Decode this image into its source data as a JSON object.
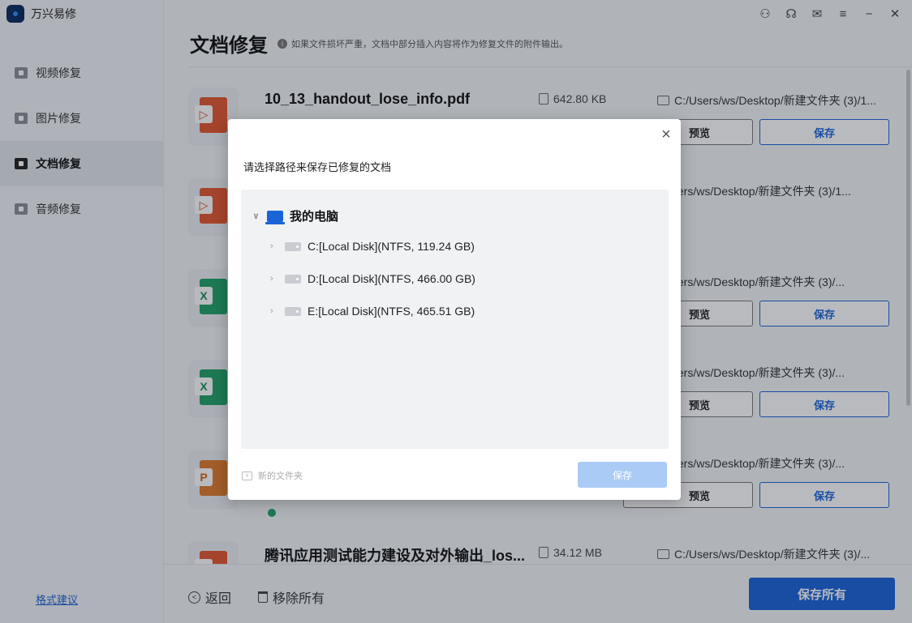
{
  "app": {
    "title": "万兴易修"
  },
  "titlebar": {
    "icons": [
      "user-icon",
      "headset-icon",
      "mail-icon",
      "menu-icon",
      "minimize-icon",
      "close-icon"
    ]
  },
  "sidebar": {
    "items": [
      {
        "label": "视频修复",
        "icon": "video-icon",
        "active": false
      },
      {
        "label": "图片修复",
        "icon": "image-icon",
        "active": false
      },
      {
        "label": "文档修复",
        "icon": "document-icon",
        "active": true
      },
      {
        "label": "音频修复",
        "icon": "audio-icon",
        "active": false
      }
    ],
    "feedback_label": "格式建议"
  },
  "main": {
    "title": "文档修复",
    "hint": "如果文件损坏严重，文档中部分插入内容将作为修复文件的附件输出。",
    "files": [
      {
        "name": "10_13_handout_lose_info.pdf",
        "size": "642.80  KB",
        "path": "C:/Users/ws/Desktop/新建文件夹 (3)/1...",
        "type": "pdf"
      },
      {
        "name": "",
        "size": "",
        "path": ":/Users/ws/Desktop/新建文件夹 (3)/1...",
        "type": "ppt"
      },
      {
        "name": "",
        "size": "",
        "path": ":/Users/ws/Desktop/新建文件夹 (3)/...",
        "type": "xls"
      },
      {
        "name": "",
        "size": "",
        "path": ":/Users/ws/Desktop/新建文件夹 (3)/...",
        "type": "xls"
      },
      {
        "name": "",
        "size": "",
        "path": ":/Users/ws/Desktop/新建文件夹 (3)/...",
        "type": "pp2"
      },
      {
        "name": "腾讯应用测试能力建设及对外输出_los...",
        "size": "34.12  MB",
        "path": "C:/Users/ws/Desktop/新建文件夹 (3)/...",
        "type": "ppt"
      }
    ],
    "preview_label": "预览",
    "save_label": "保存"
  },
  "bottombar": {
    "back_label": "返回",
    "remove_label": "移除所有",
    "save_all_label": "保存所有"
  },
  "dialog": {
    "title": "请选择路径来保存已修复的文档",
    "root_label": "我的电脑",
    "drives": [
      {
        "label": "C:[Local Disk](NTFS, 119.24  GB)"
      },
      {
        "label": "D:[Local Disk](NTFS, 466.00  GB)"
      },
      {
        "label": "E:[Local Disk](NTFS, 465.51  GB)"
      }
    ],
    "new_folder_label": "新的文件夹",
    "save_label": "保存"
  }
}
